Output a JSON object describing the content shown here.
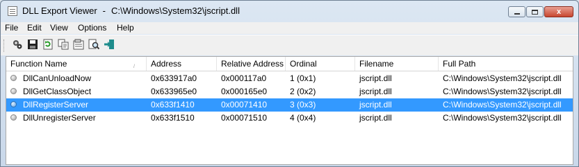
{
  "window": {
    "app_name": "DLL Export Viewer",
    "path": "C:\\Windows\\System32\\jscript.dll",
    "close_glyph": "x"
  },
  "menu": [
    "File",
    "Edit",
    "View",
    "Options",
    "Help"
  ],
  "toolbar_icons": [
    "properties-gear-icon",
    "save-icon",
    "refresh-icon",
    "copy-icon",
    "html-report-icon",
    "find-icon",
    "exit-icon"
  ],
  "list": {
    "columns": [
      "Function Name",
      "Address",
      "Relative Address",
      "Ordinal",
      "Filename",
      "Full Path"
    ],
    "sort_indicator": "/",
    "rows": [
      {
        "name": "DllCanUnloadNow",
        "address": "0x633917a0",
        "relative": "0x000117a0",
        "ordinal": "1 (0x1)",
        "filename": "jscript.dll",
        "path": "C:\\Windows\\System32\\jscript.dll",
        "selected": false
      },
      {
        "name": "DllGetClassObject",
        "address": "0x633965e0",
        "relative": "0x000165e0",
        "ordinal": "2 (0x2)",
        "filename": "jscript.dll",
        "path": "C:\\Windows\\System32\\jscript.dll",
        "selected": false
      },
      {
        "name": "DllRegisterServer",
        "address": "0x633f1410",
        "relative": "0x00071410",
        "ordinal": "3 (0x3)",
        "filename": "jscript.dll",
        "path": "C:\\Windows\\System32\\jscript.dll",
        "selected": true
      },
      {
        "name": "DllUnregisterServer",
        "address": "0x633f1510",
        "relative": "0x00071510",
        "ordinal": "4 (0x4)",
        "filename": "jscript.dll",
        "path": "C:\\Windows\\System32\\jscript.dll",
        "selected": false
      }
    ]
  },
  "colors": {
    "selection": "#3399ff",
    "chrome": "#f0f0f0"
  }
}
